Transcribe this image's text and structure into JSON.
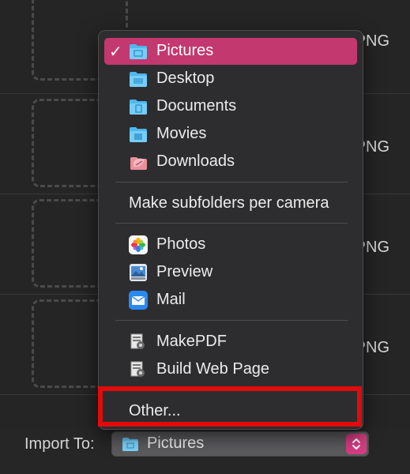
{
  "background": {
    "rows": [
      {
        "ext": "PNG"
      },
      {
        "ext": "PNG"
      },
      {
        "ext": "PNG"
      },
      {
        "ext": "PNG"
      }
    ]
  },
  "menu": {
    "folders": [
      {
        "label": "Pictures",
        "icon": "pictures-folder-icon",
        "selected": true
      },
      {
        "label": "Desktop",
        "icon": "desktop-folder-icon"
      },
      {
        "label": "Documents",
        "icon": "documents-folder-icon"
      },
      {
        "label": "Movies",
        "icon": "movies-folder-icon"
      },
      {
        "label": "Downloads",
        "icon": "downloads-folder-icon"
      }
    ],
    "check_mark": "✓",
    "subfolders_label": "Make subfolders per camera",
    "apps": [
      {
        "label": "Photos",
        "icon": "photos-app-icon"
      },
      {
        "label": "Preview",
        "icon": "preview-app-icon"
      },
      {
        "label": "Mail",
        "icon": "mail-app-icon"
      }
    ],
    "scripts": [
      {
        "label": "MakePDF",
        "icon": "script-icon"
      },
      {
        "label": "Build Web Page",
        "icon": "script-icon"
      }
    ],
    "other_label": "Other..."
  },
  "import_to": {
    "label": "Import To:",
    "value": "Pictures"
  },
  "colors": {
    "selection": "#c3386e",
    "highlight": "#e10b0b",
    "stepper": "#d63d83"
  }
}
